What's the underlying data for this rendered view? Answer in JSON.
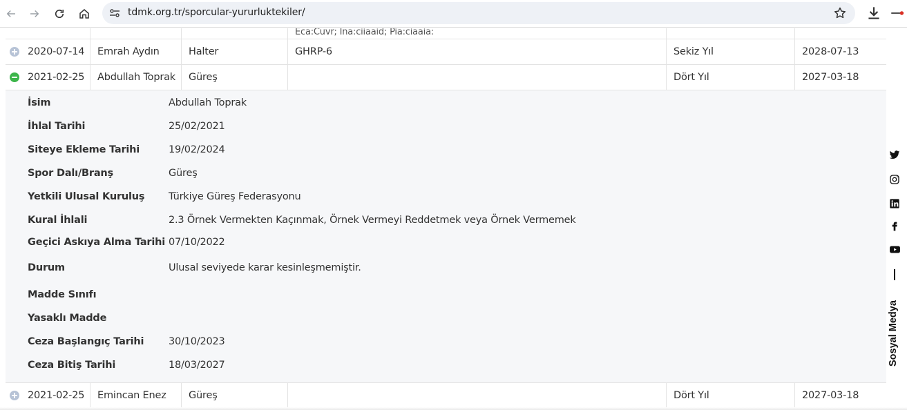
{
  "browser": {
    "url": "tdmk.org.tr/sporcular-yururluktekiler/"
  },
  "cut_row_text": "Eca:Cuvr; Ina:ciiaaid; Pia:ciaaia:",
  "rows": [
    {
      "date": "2020-07-14",
      "name": "Emrah Aydın",
      "sport": "Halter",
      "substance": "GHRP-6",
      "duration": "Sekiz Yıl",
      "end": "2028-07-13",
      "expanded": false
    },
    {
      "date": "2021-02-25",
      "name": "Abdullah Toprak",
      "sport": "Güreş",
      "substance": "",
      "duration": "Dört Yıl",
      "end": "2027-03-18",
      "expanded": true
    },
    {
      "date": "2021-02-25",
      "name": "Emincan Enez",
      "sport": "Güreş",
      "substance": "",
      "duration": "Dört Yıl",
      "end": "2027-03-18",
      "expanded": false
    }
  ],
  "detail": [
    {
      "label": "İsim",
      "value": "Abdullah Toprak"
    },
    {
      "label": "İhlal Tarihi",
      "value": "25/02/2021"
    },
    {
      "label": "Siteye Ekleme Tarihi",
      "value": "19/02/2024"
    },
    {
      "label": "Spor Dalı/Branş",
      "value": "Güreş"
    },
    {
      "label": "Yetkili Ulusal Kuruluş",
      "value": "Türkiye Güreş Federasyonu"
    },
    {
      "label": "Kural İhlali",
      "value": "2.3 Örnek Vermekten Kaçınmak, Örnek Vermeyi Reddetmek veya Örnek Vermemek"
    },
    {
      "label": "Geçici Askıya Alma Tarihi",
      "value": "07/10/2022"
    },
    {
      "label": "Durum",
      "value": "Ulusal seviyede karar kesinleşmemiştir."
    },
    {
      "label": "Madde Sınıfı",
      "value": ""
    },
    {
      "label": "Yasaklı Madde",
      "value": ""
    },
    {
      "label": "Ceza Başlangıç Tarihi",
      "value": "30/10/2023"
    },
    {
      "label": "Ceza Bitiş Tarihi",
      "value": "18/03/2027"
    }
  ],
  "social": {
    "label": "Sosyal Medya",
    "icons": [
      "twitter-icon",
      "instagram-icon",
      "linkedin-icon",
      "facebook-icon",
      "youtube-icon"
    ]
  }
}
